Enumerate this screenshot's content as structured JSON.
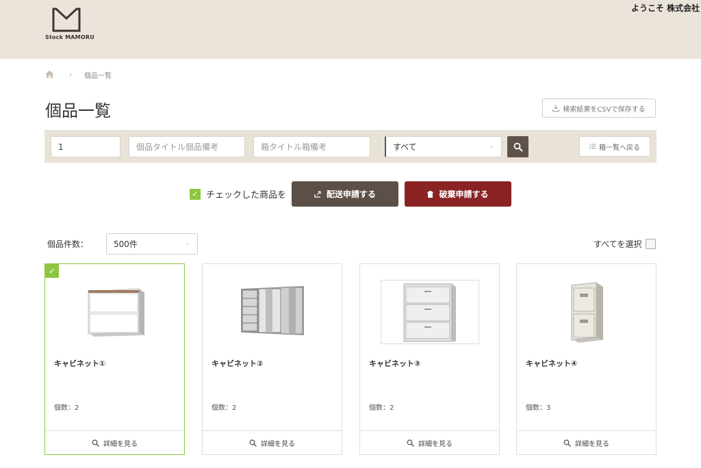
{
  "header": {
    "logo_text": "Stock MAMORU",
    "welcome": "ようこそ 株式会社"
  },
  "breadcrumb": {
    "home_icon": "home-icon",
    "current": "個品一覧"
  },
  "page": {
    "title": "個品一覧",
    "csv_button": "検索結果をCSVで保存する"
  },
  "search": {
    "field1_value": "1",
    "field2_placeholder": "個品タイトル個品備考",
    "field3_placeholder": "箱タイトル箱備考",
    "status_value": "すべて",
    "back_button": "箱一覧へ戻る"
  },
  "actions": {
    "checked_label": "チェックした商品を",
    "ship_button": "配送申請する",
    "dispose_button": "破棄申請する"
  },
  "list": {
    "count_label": "個品件数：",
    "count_value": "500件",
    "select_all": "すべてを選択"
  },
  "items": [
    {
      "name": "キャビネット①",
      "qty": "個数：2",
      "detail": "詳細を見る",
      "checked": true
    },
    {
      "name": "キャビネット②",
      "qty": "個数：2",
      "detail": "詳細を見る",
      "checked": false
    },
    {
      "name": "キャビネット③",
      "qty": "個数：2",
      "detail": "詳細を見る",
      "checked": false
    },
    {
      "name": "キャビネット④",
      "qty": "個数：3",
      "detail": "詳細を見る",
      "checked": false
    }
  ],
  "colors": {
    "header_bg": "#ebe4da",
    "accent_green": "#8dc63f",
    "ship_button": "#5b4f47",
    "dispose_button": "#8b2224"
  }
}
